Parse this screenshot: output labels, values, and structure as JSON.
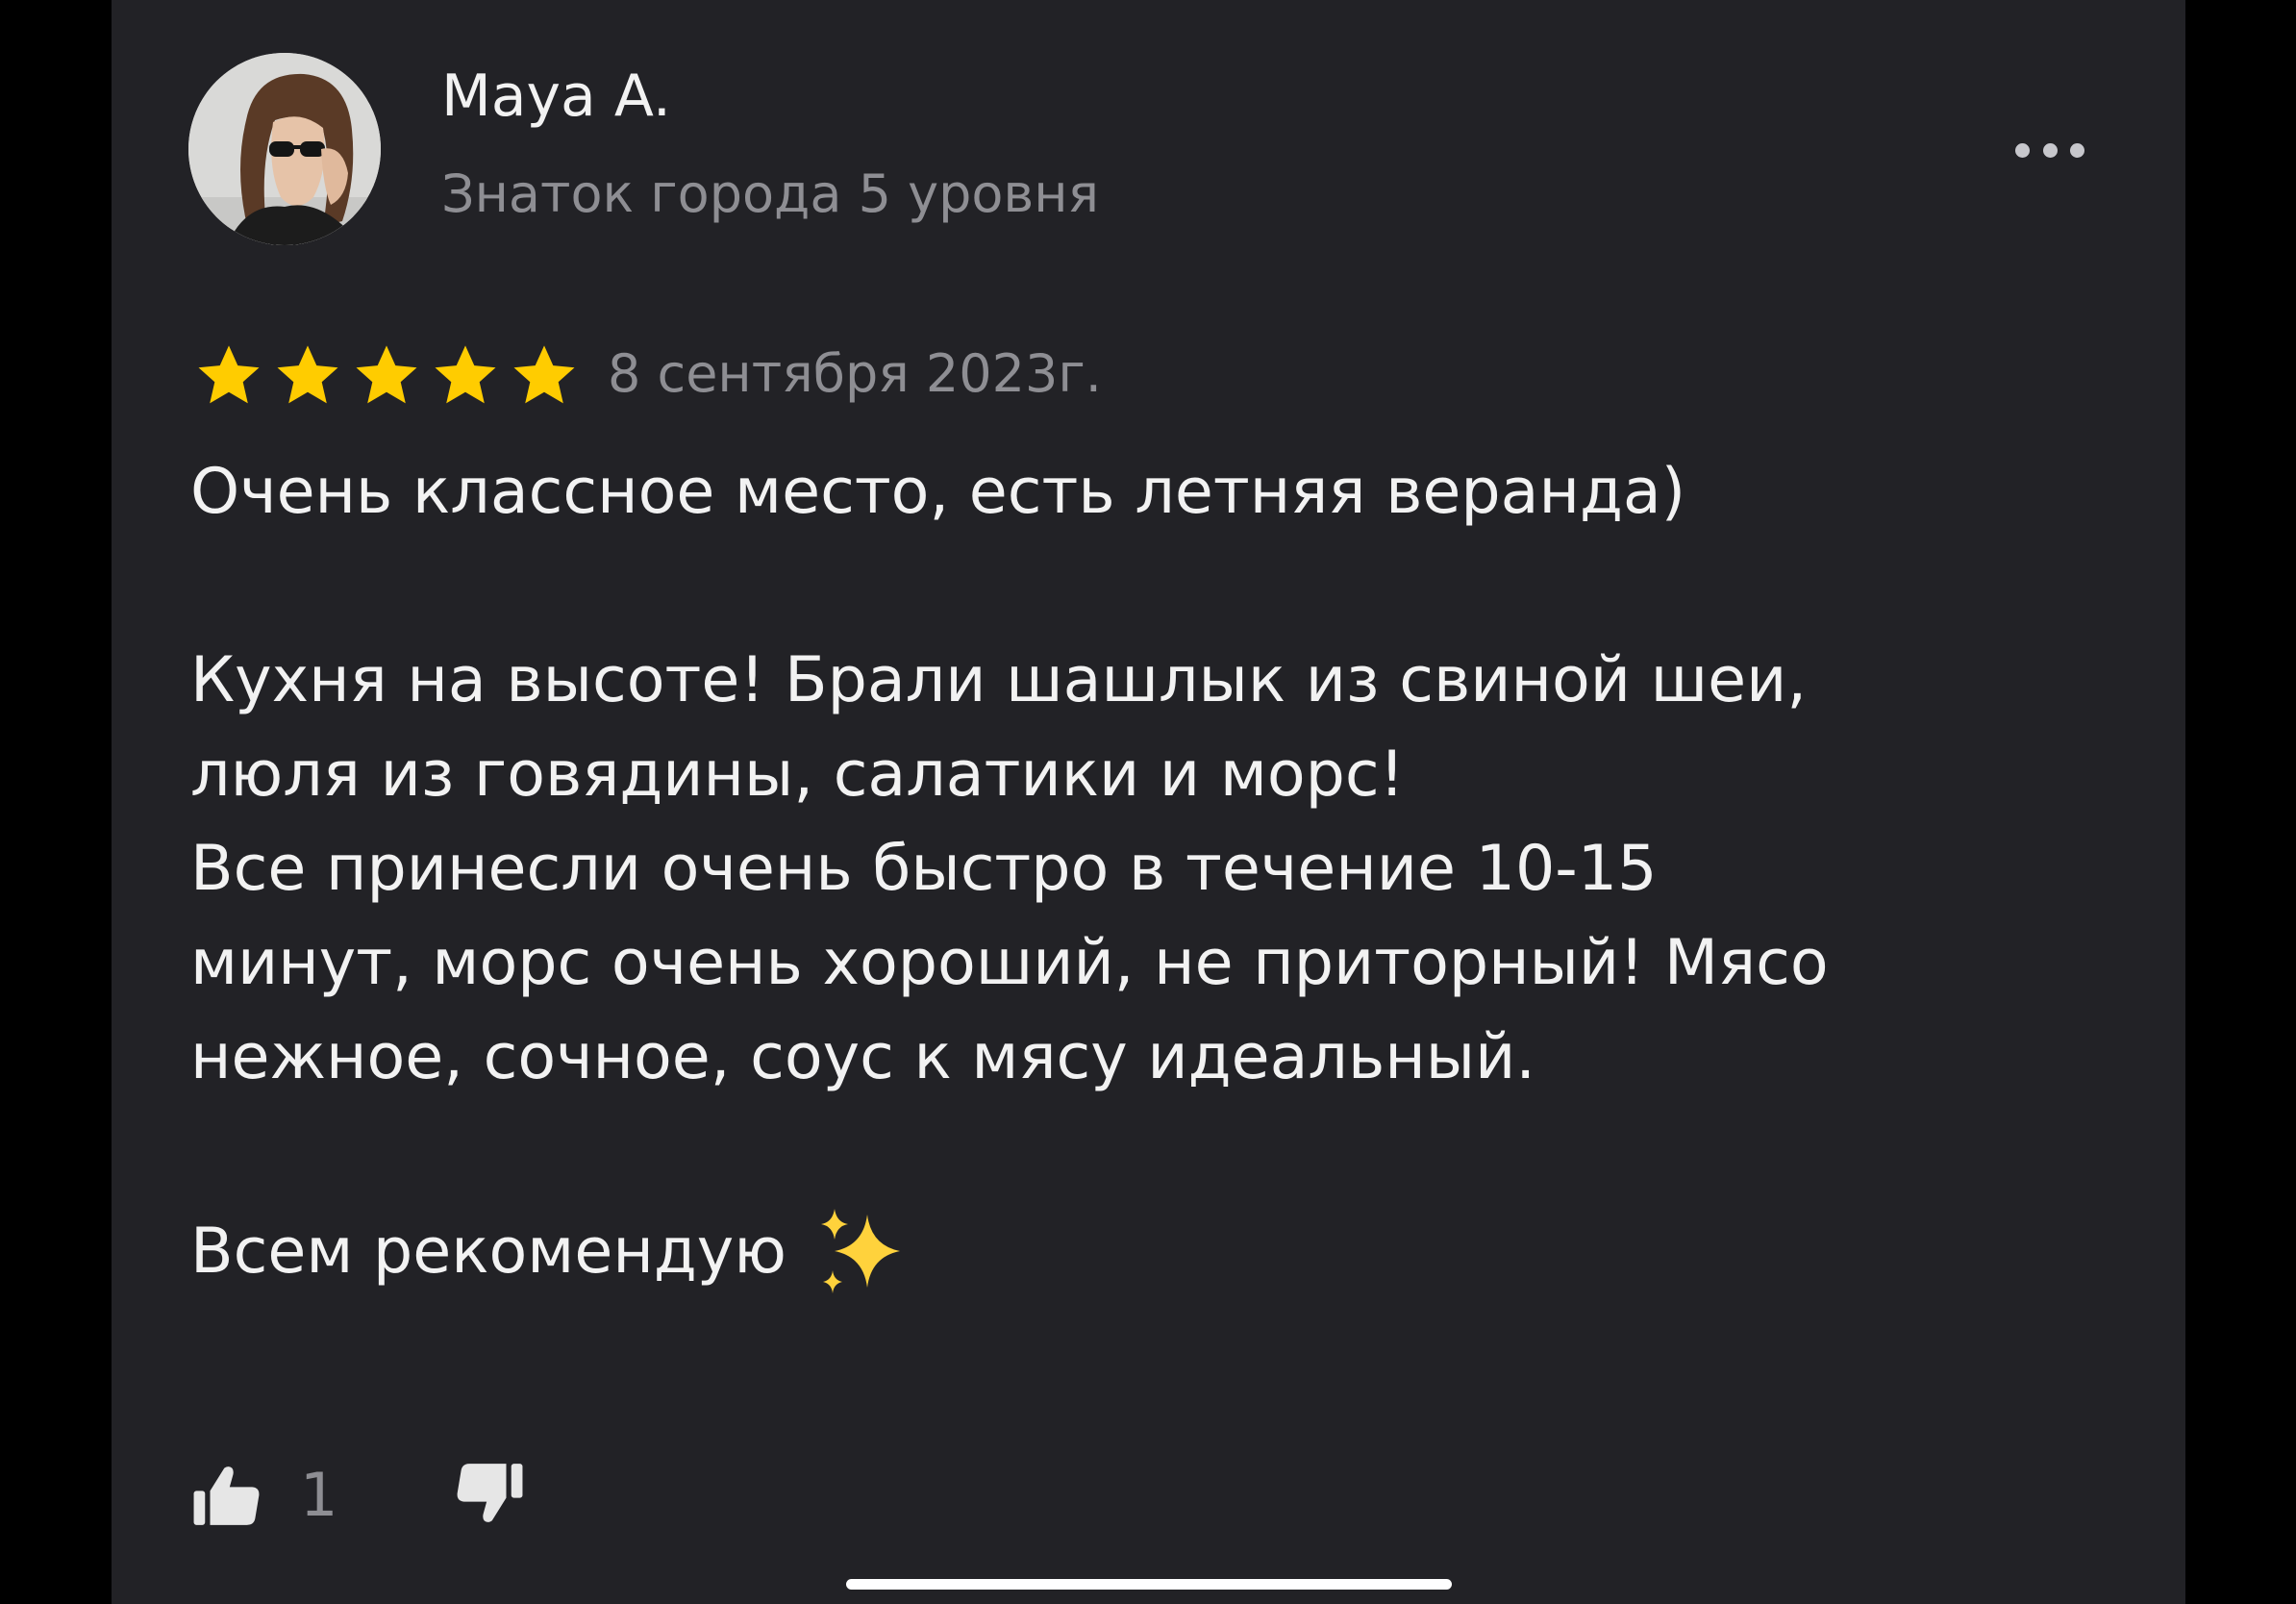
{
  "review": {
    "author": {
      "name": "Maya A.",
      "level": "Знаток города 5 уровня"
    },
    "rating": 5,
    "rating_max": 5,
    "date": "8 сентября 2023г.",
    "text": {
      "p1": "Очень классное место, есть летняя веранда)",
      "p2_line1": "Кухня на высоте! Брали шашлык из свиной шеи,",
      "p2_line2": "люля из говядины, салатики и морс!",
      "p2_line3": "Все принесли очень быстро в течение 10-15",
      "p2_line4": "минут, морс очень хороший, не приторный! Мясо",
      "p2_line5": "нежное, сочное, соус к мясу идеальный.",
      "p3": "Всем рекомендую"
    },
    "likes": "1"
  },
  "icons": {
    "more": "ellipsis-icon",
    "star": "star-icon",
    "sparkles": "sparkles-icon",
    "like": "thumbs-up-icon",
    "dislike": "thumbs-down-icon"
  },
  "colors": {
    "background": "#222226",
    "star": "#ffcc00",
    "primary_text": "#f2f2f2",
    "secondary_text": "#8e8e93"
  }
}
